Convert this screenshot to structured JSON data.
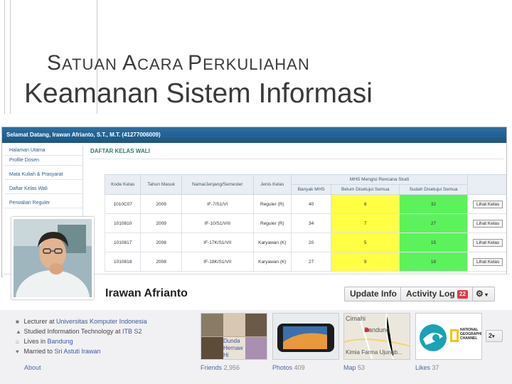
{
  "slide": {
    "subtitle_parts": [
      {
        "big": "S",
        "rest": "ATUAN "
      },
      {
        "big": "A",
        "rest": "CARA "
      },
      {
        "big": "P",
        "rest": "ERKULIAHAN"
      }
    ],
    "title": "Keamanan Sistem Informasi"
  },
  "portal": {
    "welcome": "Selamat Datang, Irawan Afrianto, S.T., M.T. (41277006009)",
    "nav": [
      "Halaman Utama",
      "Profile Dosen",
      "Mata Kuliah & Prasyarat",
      "Daftar Kelas Wali",
      "Perwalian Reguler"
    ],
    "heading": "DAFTAR KELAS WALI",
    "columns": [
      "Kode Kelas",
      "Tahun Masuk",
      "Nama/Jenjang/Semester",
      "Jenis Kelas",
      "MHS Mengisi Rencana Studi"
    ],
    "subcolumns": [
      "Banyak MHS",
      "Belum Disetujui Semua",
      "Sudah Disetujui Semua"
    ],
    "rows": [
      {
        "kode": "1010C07",
        "tahun": "2009",
        "nama": "IF-7/S1/VI",
        "jenis": "Reguler (R)",
        "banyak": "40",
        "belum": "8",
        "sudah": "32",
        "aksi": "Lihat Kelas"
      },
      {
        "kode": "1010810",
        "tahun": "2009",
        "nama": "IF-10/S1/VIII",
        "jenis": "Reguler (R)",
        "banyak": "34",
        "belum": "7",
        "sudah": "27",
        "aksi": "Lihat Kelas"
      },
      {
        "kode": "1010817",
        "tahun": "2008",
        "nama": "IF-17K/S1/VII",
        "jenis": "Karyawan (K)",
        "banyak": "20",
        "belum": "5",
        "sudah": "15",
        "aksi": "Lihat Kelas"
      },
      {
        "kode": "1010818",
        "tahun": "2008",
        "nama": "IF-18K/S1/VII",
        "jenis": "Karyawan (K)",
        "banyak": "27",
        "belum": "9",
        "sudah": "18",
        "aksi": "Lihat Kelas"
      }
    ],
    "colors": {
      "belum": "#ffff44",
      "sudah": "#5cf25c",
      "header_bar": "#1b5581"
    }
  },
  "facebook": {
    "name": "Irawan Afrianto",
    "update_info": "Update Info",
    "activity_log": "Activity Log",
    "activity_badge": "22",
    "settings_icon": "gear-icon",
    "info": [
      {
        "icon": "briefcase-icon",
        "prefix": "Lecturer at ",
        "link": "Universitas Komputer Indonesia"
      },
      {
        "icon": "graduation-icon",
        "prefix": "Studied Information Technology at ",
        "link": "ITB S2"
      },
      {
        "icon": "home-icon",
        "prefix": "Lives in ",
        "link": "Bandung"
      },
      {
        "icon": "heart-icon",
        "prefix": "Married to ",
        "link": "Sri Astuti Irawan"
      }
    ],
    "about": "About",
    "friends": {
      "label": "Friends",
      "count": "2,956",
      "names": [
        "Dunda",
        "Hernaw",
        "Hi"
      ]
    },
    "photos": {
      "label": "Photos",
      "count": "409"
    },
    "map": {
      "label": "Map",
      "count": "53",
      "city1": "Cimahi",
      "city2": "Bandung",
      "place": "Kimia Farma Ujungb..."
    },
    "likes": {
      "label": "Likes",
      "count": "37",
      "page": "NATIONAL GEOGRAPHIC CHANNEL"
    },
    "more_count": "2"
  }
}
